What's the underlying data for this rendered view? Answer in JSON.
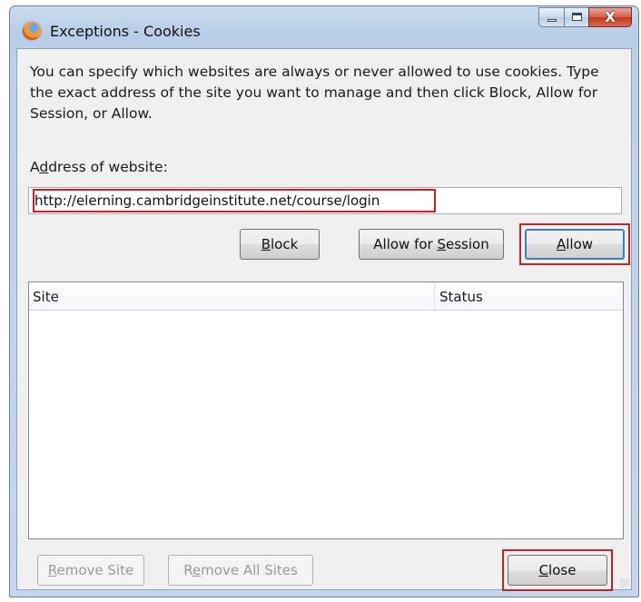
{
  "window": {
    "title": "Exceptions - Cookies",
    "icon": "firefox-icon",
    "minimize_glyph": "",
    "maximize_glyph": "",
    "close_glyph": "X"
  },
  "intro_text": "You can specify which websites are always or never allowed to use cookies. Type the exact address of the site you want to manage and then click Block, Allow for Session, or Allow.",
  "address": {
    "label_pre": "A",
    "label_key": "d",
    "label_post": "dress of website:",
    "value": "http://elerning.cambridgeinstitute.net/course/login"
  },
  "buttons": {
    "block_key": "B",
    "block_rest": "lock",
    "session_pre": "Allow for ",
    "session_key": "S",
    "session_rest": "ession",
    "allow_key": "A",
    "allow_rest": "llow",
    "remove_site_key": "R",
    "remove_site_rest": "emove Site",
    "remove_all_pre": "R",
    "remove_all_key": "e",
    "remove_all_rest": "move All Sites",
    "close_key": "C",
    "close_rest": "lose"
  },
  "sites_table": {
    "columns": [
      "Site",
      "Status"
    ],
    "rows": []
  },
  "colors": {
    "highlight_red": "#c3222a",
    "title_bar": "#bcd1e9",
    "dialog_bg": "#f0f0f0"
  }
}
